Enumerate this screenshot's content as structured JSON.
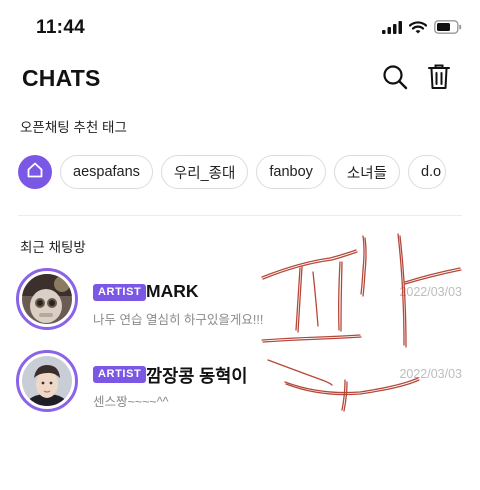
{
  "status_bar": {
    "time": "11:44"
  },
  "header": {
    "title": "CHATS"
  },
  "tags": {
    "section_label": "오픈채팅 추천 태그",
    "items": [
      "aespafans",
      "우리_종대",
      "fanboy",
      "소녀들",
      "d.o"
    ]
  },
  "recent": {
    "section_label": "최근 채팅방",
    "chats": [
      {
        "badge": "ARTIST",
        "name": "MARK",
        "date": "2022/03/03",
        "message": "나두 연습 열심히 하구있을게요!!!"
      },
      {
        "badge": "ARTIST",
        "name": "깜장콩 동혁이",
        "date": "2022/03/03",
        "message": "센스짱~~~~^^"
      }
    ]
  },
  "handwritten_overlay": {
    "text": "표한",
    "color": "#b5483a"
  },
  "colors": {
    "accent": "#7b57e5",
    "avatar_ring": "#8a63e8",
    "date_text": "#bdbdbd"
  },
  "icons": [
    "cellular-signal-icon",
    "wifi-icon",
    "battery-icon",
    "search-icon",
    "trash-icon",
    "home-icon"
  ]
}
